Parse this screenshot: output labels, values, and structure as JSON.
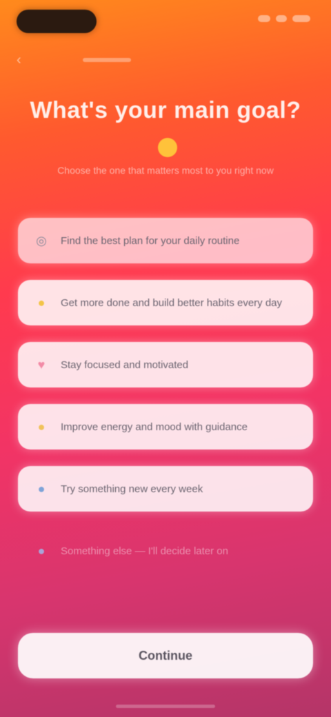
{
  "status_bar": {
    "indicators": [
      "cellular-icon",
      "wifi-icon",
      "battery-icon"
    ]
  },
  "header": {
    "back_icon": "chevron-left-icon",
    "title": "What's your main goal?",
    "title_emoji": "smile-emoji-icon",
    "subtitle": "Choose the one that matters most to you right now"
  },
  "options": [
    {
      "icon": "target-icon",
      "icon_glyph": "◎",
      "icon_color": "#8a8a9a",
      "label": "Find the best plan for your daily routine"
    },
    {
      "icon": "star-icon",
      "icon_glyph": "●",
      "icon_color": "#f3c447",
      "label": "Get more done and build better habits every day"
    },
    {
      "icon": "heart-icon",
      "icon_glyph": "♥",
      "icon_color": "#f28aa6",
      "label": "Stay focused and motivated"
    },
    {
      "icon": "sun-icon",
      "icon_glyph": "●",
      "icon_color": "#f0c25a",
      "label": "Improve energy and mood with guidance"
    },
    {
      "icon": "globe-icon",
      "icon_glyph": "●",
      "icon_color": "#7ea3d8",
      "label": "Try something new every week"
    },
    {
      "icon": "dots-icon",
      "icon_glyph": "●",
      "icon_color": "#a9a4d8",
      "label": "Something else — I'll decide later on"
    }
  ],
  "footer": {
    "continue_label": "Continue"
  },
  "colors": {
    "gradient_top": "#ff8a1c",
    "gradient_mid": "#ff3a4e",
    "gradient_bottom": "#b43568",
    "option_bg": "#ffffff"
  }
}
